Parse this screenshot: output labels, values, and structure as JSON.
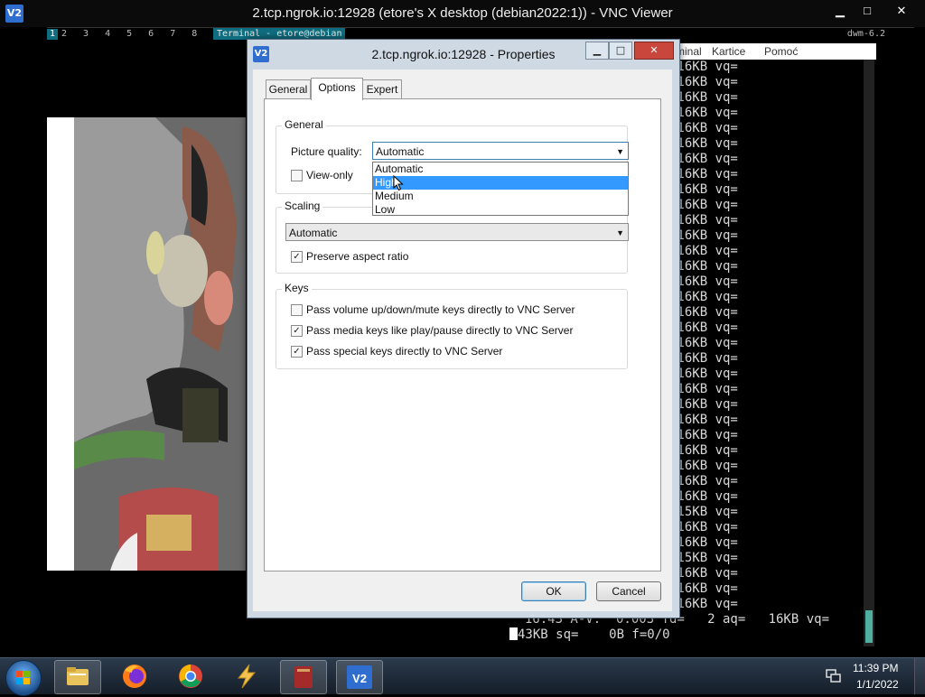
{
  "vnc_window": {
    "title": "2.tcp.ngrok.io:12928 (etore's X desktop (debian2022:1)) - VNC Viewer",
    "icon_label": "V2",
    "minimize": "▁",
    "maximize": "□",
    "close": "✕"
  },
  "remote_desktop": {
    "dwm_bar": {
      "current_tag": "1",
      "tags": "2 3 4 5 6 7 8 9",
      "layout_symbol": "[]=",
      "window_title": "Terminal - etore@debian",
      "version": "dwm-6.2"
    },
    "terminal": {
      "menu": [
        "minal",
        "Kartice",
        "Pomoć"
      ],
      "lines": [
        "              2 aq=   16KB vq=",
        "              2 aq=   16KB vq=",
        "              2 aq=   16KB vq=",
        "              2 aq=   16KB vq=",
        "              2 aq=   16KB vq=",
        "              2 aq=   16KB vq=",
        "              2 aq=   16KB vq=",
        "              2 aq=   16KB vq=",
        "              2 aq=   16KB vq=",
        "              2 aq=   16KB vq=",
        "              2 aq=   16KB vq=",
        "              2 aq=   16KB vq=",
        "              2 aq=   16KB vq=",
        "              2 aq=   16KB vq=",
        "              2 aq=   16KB vq=",
        "              2 aq=   16KB vq=",
        "              2 aq=   16KB vq=",
        "              2 aq=   16KB vq=",
        "              2 aq=   16KB vq=",
        "              2 aq=   16KB vq=",
        "              2 aq=   16KB vq=",
        "              2 aq=   16KB vq=",
        "              2 aq=   16KB vq=",
        "              2 aq=   16KB vq=",
        "              2 aq=   16KB vq=",
        "              2 aq=   16KB vq=",
        "              2 aq=   16KB vq=",
        "              2 aq=   16KB vq=",
        "              2 aq=   16KB vq=",
        "              2 aq=   15KB vq=",
        "              2 aq=   16KB vq=",
        "              2 aq=   16KB vq=",
        "              2 aq=   15KB vq=",
        "              2 aq=   16KB vq=",
        "              2 aq=   16KB vq=",
        "              2 aq=   16KB vq=",
        "  16.43 A-V:  0.003 fd=   2 aq=   16KB vq="
      ],
      "last_line": "43KB sq=    0B f=0/0"
    }
  },
  "dialog": {
    "title": "2.tcp.ngrok.io:12928 - Properties",
    "icon_label": "V2",
    "tabs": [
      "General",
      "Options",
      "Expert"
    ],
    "active_tab": "Options",
    "general_group": {
      "label": "General",
      "picture_quality_label": "Picture quality:",
      "picture_quality_value": "Automatic",
      "view_only_label": "View-only",
      "view_only_checked": false,
      "dropdown_options": [
        "Automatic",
        "High",
        "Medium",
        "Low"
      ],
      "highlighted_option": "High"
    },
    "scaling_group": {
      "label": "Scaling",
      "value": "Automatic",
      "preserve_aspect_label": "Preserve aspect ratio",
      "preserve_aspect_checked": true
    },
    "keys_group": {
      "label": "Keys",
      "options": [
        {
          "label": "Pass volume up/down/mute keys directly to VNC Server",
          "checked": false
        },
        {
          "label": "Pass media keys like play/pause directly to VNC Server",
          "checked": true
        },
        {
          "label": "Pass special keys directly to VNC Server",
          "checked": true
        }
      ]
    },
    "buttons": {
      "ok": "OK",
      "cancel": "Cancel"
    }
  },
  "taskbar": {
    "items": [
      "start-orb",
      "file-explorer",
      "firefox",
      "chrome",
      "app-lightning",
      "app-red-book",
      "vnc-viewer"
    ],
    "active_item": "vnc-viewer",
    "clock_time": "11:39 PM",
    "clock_date": "1/1/2022"
  },
  "colors": {
    "dwm_accent": "#0e6e80",
    "selection_blue": "#3399ff",
    "vnc_blue": "#2f6ecf",
    "close_red": "#c9463d"
  }
}
